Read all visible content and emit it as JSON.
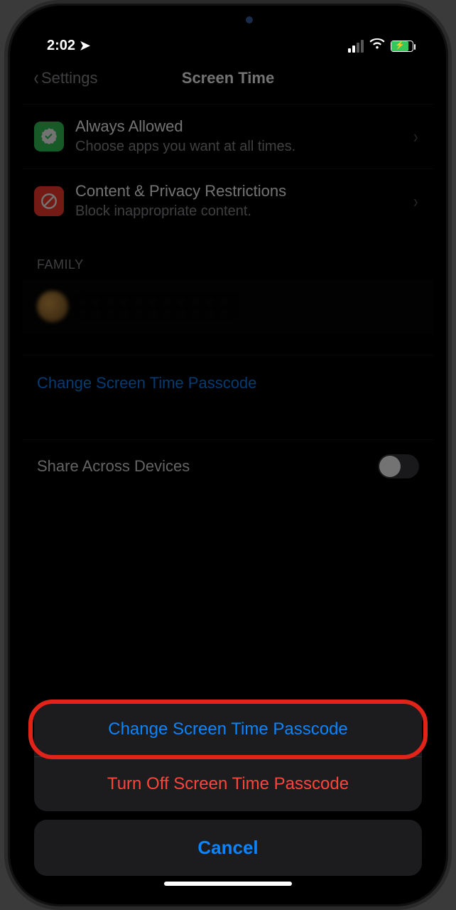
{
  "status": {
    "time": "2:02",
    "battery_color": "#34c759"
  },
  "nav": {
    "back_label": "Settings",
    "title": "Screen Time"
  },
  "rows": {
    "always_allowed": {
      "title": "Always Allowed",
      "subtitle": "Choose apps you want at all times.",
      "icon_bg": "#34c759"
    },
    "content_privacy": {
      "title": "Content & Privacy Restrictions",
      "subtitle": "Block inappropriate content.",
      "icon_bg": "#ff3b30"
    }
  },
  "sections": {
    "family_header": "FAMILY"
  },
  "links": {
    "change_passcode": "Change Screen Time Passcode"
  },
  "toggle": {
    "share_label": "Share Across Devices"
  },
  "action_sheet": {
    "change": "Change Screen Time Passcode",
    "turn_off": "Turn Off Screen Time Passcode",
    "cancel": "Cancel"
  },
  "highlighted_option": "change"
}
